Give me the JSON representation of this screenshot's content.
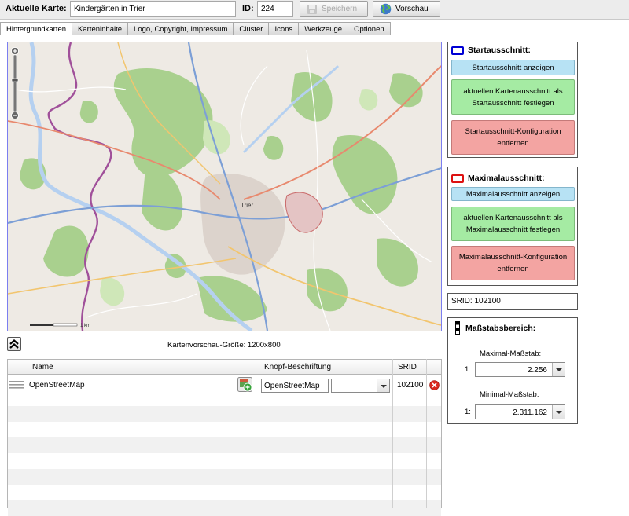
{
  "toolbar": {
    "map_label": "Aktuelle Karte:",
    "map_name": "Kindergärten in Trier",
    "id_label": "ID:",
    "id_value": "224",
    "save_label": "Speichern",
    "preview_label": "Vorschau"
  },
  "tabs": [
    "Hintergrundkarten",
    "Karteninhalte",
    "Logo, Copyright, Impressum",
    "Cluster",
    "Icons",
    "Werkzeuge",
    "Optionen"
  ],
  "map": {
    "preview_size": "Kartenvorschau-Größe: 1200x800",
    "place_label": "Trier",
    "scale_bar_label": "1 km"
  },
  "start_panel": {
    "title": "Startausschnitt:",
    "show_btn": "Startausschnitt anzeigen",
    "set_btn": "aktuellen Kartenausschnitt als Startausschnitt festlegen",
    "remove_btn": "Startausschnitt-Konfiguration entfernen"
  },
  "max_panel": {
    "title": "Maximalausschnitt:",
    "show_btn": "Maximalausschnitt anzeigen",
    "set_btn": "aktuellen Kartenausschnitt als Maximalausschnitt festlegen",
    "remove_btn": "Maximalausschnitt-Konfiguration entfernen"
  },
  "srid": "SRID: 102100",
  "scale_panel": {
    "title": "Maßstabsbereich:",
    "max_label": "Maximal-Maßstab:",
    "max_prefix": "1:",
    "max_value": "2.256",
    "min_label": "Minimal-Maßstab:",
    "min_prefix": "1:",
    "min_value": "2.311.162"
  },
  "grid": {
    "columns": {
      "name": "Name",
      "button_label": "Knopf-Beschriftung",
      "srid": "SRID"
    },
    "rows": [
      {
        "name": "OpenStreetMap",
        "button_label": "OpenStreetMap",
        "select_value": "",
        "srid": "102100"
      }
    ]
  },
  "colors": {
    "start_frame": "#0000d4",
    "max_frame": "#dd1111",
    "map_border": "#7b7ef0"
  }
}
